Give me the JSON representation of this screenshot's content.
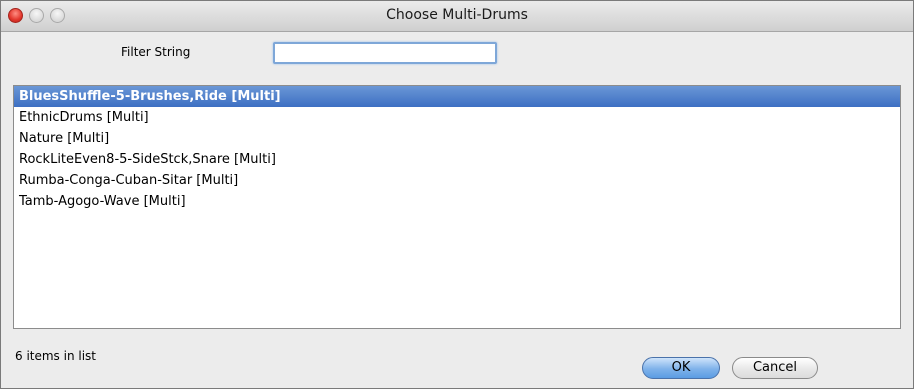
{
  "window": {
    "title": "Choose Multi-Drums"
  },
  "filter": {
    "label": "Filter String",
    "value": "",
    "placeholder": ""
  },
  "list": {
    "items": [
      {
        "label": "BluesShuffle-5-Brushes,Ride [Multi]",
        "selected": true
      },
      {
        "label": "EthnicDrums [Multi]",
        "selected": false
      },
      {
        "label": "Nature [Multi]",
        "selected": false
      },
      {
        "label": "RockLiteEven8-5-SideStck,Snare [Multi]",
        "selected": false
      },
      {
        "label": "Rumba-Conga-Cuban-Sitar [Multi]",
        "selected": false
      },
      {
        "label": "Tamb-Agogo-Wave [Multi]",
        "selected": false
      }
    ]
  },
  "status": {
    "count_text": "6 items in list"
  },
  "buttons": {
    "ok_label": "OK",
    "cancel_label": "Cancel"
  },
  "colors": {
    "selection": "#3d6fc3",
    "default_button": "#7fb2ea",
    "close_button": "#e2352b"
  }
}
